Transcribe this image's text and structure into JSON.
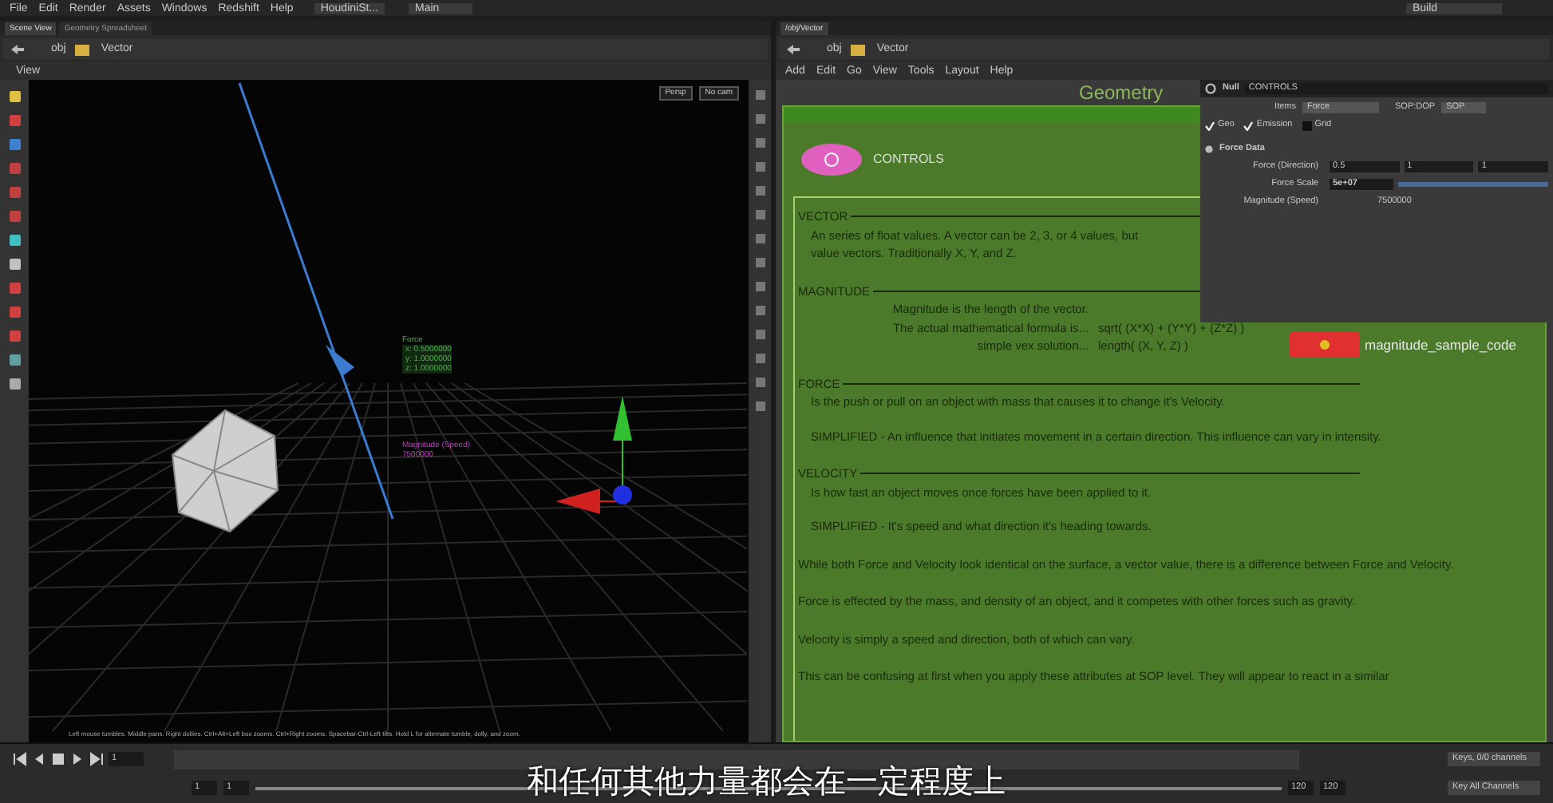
{
  "menu_bar": {
    "items": [
      "File",
      "Edit",
      "Render",
      "Assets",
      "Windows",
      "Redshift",
      "Help"
    ],
    "desktop": "HoudiniSt...",
    "desktop_2": "Main",
    "build": "Build"
  },
  "left_pane": {
    "tabs": [
      {
        "label": "Scene View",
        "selected": true
      },
      {
        "label": "Geometry Spreadsheet",
        "selected": false
      }
    ],
    "path": [
      "obj",
      "Vector"
    ],
    "view_label": "View",
    "camera_menus": [
      "Persp",
      "No cam"
    ],
    "overlay_force": {
      "title": "Force",
      "values": [
        "x: 0.5000000",
        "y: 1.0000000",
        "z: 1.0000000"
      ]
    },
    "overlay_magnitude": {
      "title": "Magnitude (Speed)",
      "value": "7500000"
    },
    "status_hint": "Left mouse tumbles. Middle pans. Right dollies. Ctrl+Alt+Left box zooms. Ctrl+Right zooms. Spacebar-Ctrl-Left tilts. Hold L for alternate tumble, dolly, and zoom."
  },
  "right_pane": {
    "tabs": [
      {
        "label": "/obj/Vector",
        "selected": true
      }
    ],
    "path": [
      "obj",
      "Vector"
    ],
    "menu": [
      "Add",
      "Edit",
      "Go",
      "View",
      "Tools",
      "Layout",
      "Help"
    ],
    "network_label": "Geometry",
    "note": {
      "sections": [
        {
          "heading": "VECTOR",
          "paragraphs": [
            {
              "kind": "text",
              "text": "An series of float values. A vector can be 2, 3, or 4 values, but\nvalue vectors. Traditionally X, Y, and Z."
            }
          ]
        },
        {
          "heading": "MAGNITUDE",
          "paragraphs": [
            {
              "kind": "formula",
              "rows": [
                [
                  "Magnitude is the length of the vector.",
                  ""
                ],
                [
                  "The actual mathematical formula is...",
                  "sqrt( (X*X) + (Y*Y) + (Z*Z) )"
                ],
                [
                  "simple vex solution...",
                  "length( (X, Y, Z) )"
                ]
              ]
            }
          ]
        },
        {
          "heading": "FORCE",
          "paragraphs": [
            {
              "kind": "text",
              "text": "Is the push or pull on an object with mass that causes it to change it's Velocity."
            },
            {
              "kind": "text",
              "text": "SIMPLIFIED - An influence that initiates movement in a certain direction. This influence can vary in intensity."
            }
          ]
        },
        {
          "heading": "VELOCITY",
          "paragraphs": [
            {
              "kind": "text",
              "text": "Is how fast an object moves once forces have been applied to it."
            },
            {
              "kind": "text",
              "text": "SIMPLIFIED - It's speed and what direction it's heading towards."
            }
          ]
        }
      ],
      "closing": [
        "While both Force and Velocity look identical on the surface, a vector value, there is a difference between Force and Velocity.",
        "Force is effected by the mass, and density of an object, and it competes with other forces such as gravity.",
        "Velocity is simply a speed and direction, both of which can vary.",
        "This can be confusing at first when you apply these attributes at SOP level. They will appear to react in a similar"
      ]
    },
    "nodes": [
      {
        "label": "CONTROLS",
        "color": "#e060c0"
      },
      {
        "label": "magnitude_sample_code",
        "color": "#e03030"
      }
    ],
    "parameters": {
      "node_type": "Null",
      "node_name": "CONTROLS",
      "items_label": "Items",
      "items_value": "Force",
      "mode_label": "SOP:DOP",
      "mode_value": "SOP",
      "toggles": [
        {
          "label": "Geo",
          "checked": true
        },
        {
          "label": "Emission",
          "checked": true
        },
        {
          "label": "Grid",
          "checked": false
        }
      ],
      "section": "Force Data",
      "rows": [
        {
          "kind": "vector",
          "label": "Force (Direction)",
          "values": [
            "0.5",
            "1",
            "1"
          ]
        },
        {
          "kind": "slider",
          "label": "Force Scale",
          "value": "5e+07",
          "level": 1
        },
        {
          "kind": "readout",
          "label": "Magnitude (Speed)",
          "value": "7500000"
        }
      ]
    }
  },
  "timeline": {
    "range": {
      "level": 1
    },
    "frame": "1",
    "range_start": "1",
    "range_start_2": "1",
    "range_end": "120",
    "range_end_2": "120",
    "keys_menu": "Keys, 0/0 channels",
    "channels_menu": "Key All Channels"
  },
  "subtitle": "和任何其他力量都会在一定程度上"
}
